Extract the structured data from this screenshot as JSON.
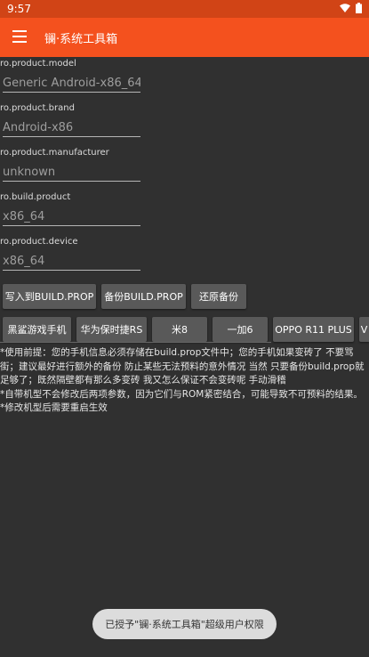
{
  "status": {
    "time": "9:57",
    "icons": [
      "wifi-icon",
      "battery-icon"
    ]
  },
  "toolbar": {
    "title": "镧·系统工具箱",
    "menu_icon": "hamburger-menu-icon"
  },
  "fields": [
    {
      "label": "ro.product.model",
      "value": "Generic Android-x86_64"
    },
    {
      "label": "ro.product.brand",
      "value": "Android-x86"
    },
    {
      "label": "ro.product.manufacturer",
      "value": "unknown"
    },
    {
      "label": "ro.build.product",
      "value": "x86_64"
    },
    {
      "label": "ro.product.device",
      "value": "x86_64"
    }
  ],
  "actions": {
    "write": "写入到BUILD.PROP",
    "backup": "备份BUILD.PROP",
    "restore": "还原备份"
  },
  "presets": [
    "黑鲨游戏手机",
    "华为保时捷RS",
    "米8",
    "一加6",
    "OPPO R11 PLUS",
    "V"
  ],
  "notes": [
    "*使用前提：您的手机信息必须存储在build.prop文件中；您的手机如果变砖了 不要骂街；建议最好进行额外的备份 防止某些无法预料的意外情况 当然 只要备份build.prop就足够了；既然隔壁都有那么多变砖 我又怎么保证不会变砖呢 手动滑稽",
    "*自带机型不会修改后两项参数，因为它们与ROM紧密结合，可能导致不可预料的结果。",
    "*修改机型后需要重启生效"
  ],
  "toast": "已授予\"镧·系统工具箱\"超级用户权限",
  "colors": {
    "accent": "#f4511e",
    "status_bar": "#d14416",
    "background": "#303030",
    "button": "#595959"
  }
}
